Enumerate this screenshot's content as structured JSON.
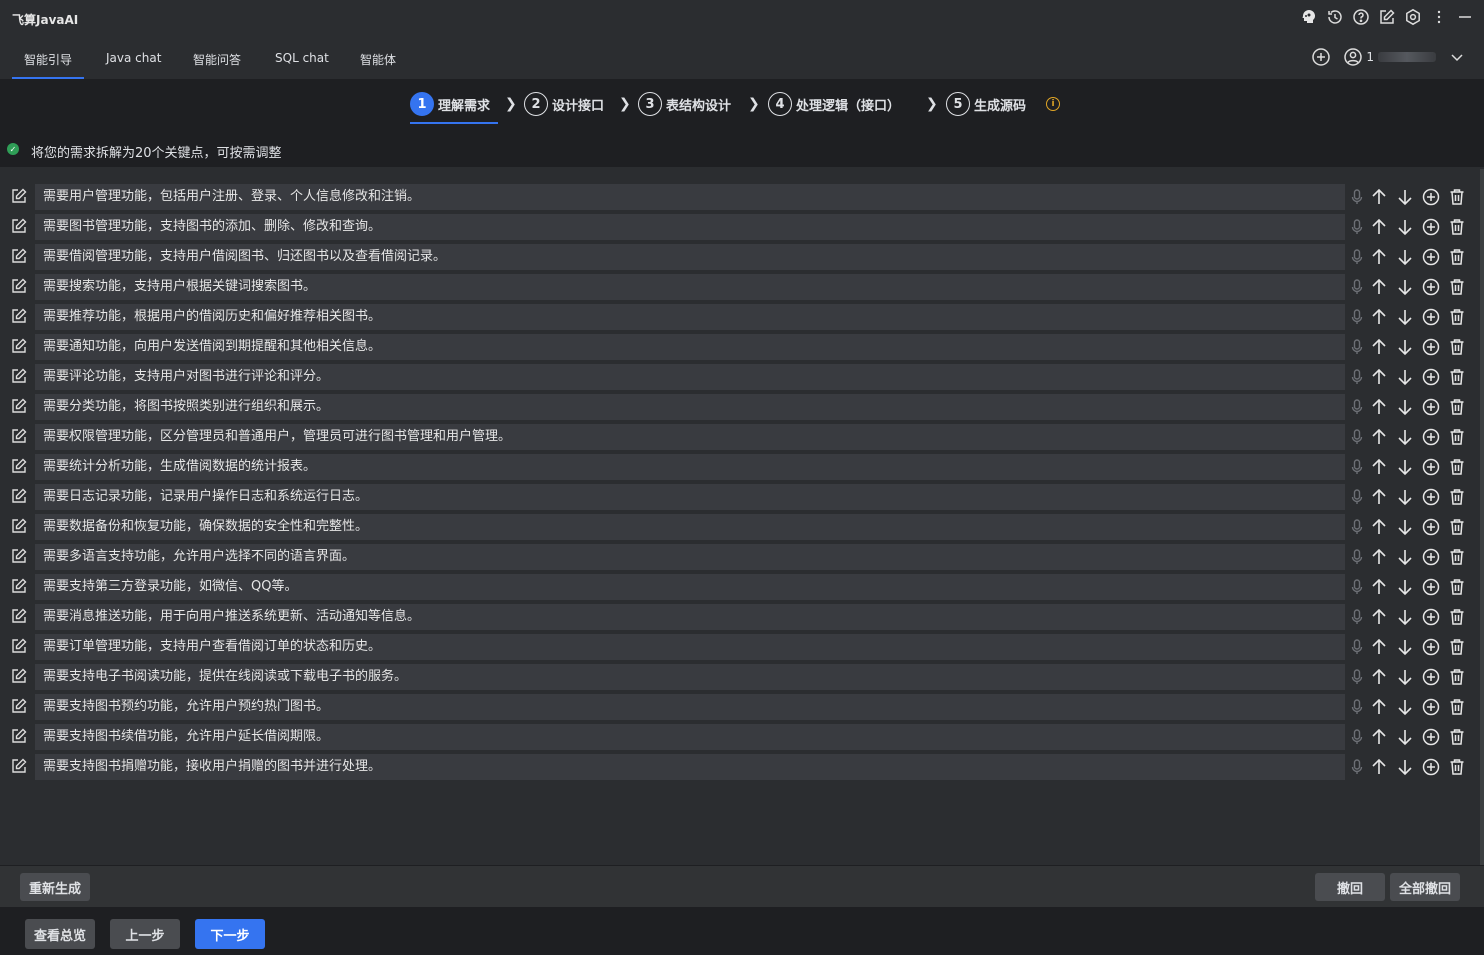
{
  "app": {
    "title": "飞算JavaAI"
  },
  "title_icons": [
    "brain-icon",
    "history-icon",
    "help-icon",
    "edit-icon",
    "settings-icon",
    "more-icon",
    "minimize-icon"
  ],
  "tabs": [
    {
      "label": "智能引导",
      "active": true
    },
    {
      "label": "Java chat",
      "active": false
    },
    {
      "label": "智能问答",
      "active": false
    },
    {
      "label": "SQL chat",
      "active": false
    },
    {
      "label": "智能体",
      "active": false
    }
  ],
  "user": {
    "name_prefix": "1"
  },
  "steps": [
    {
      "num": "1",
      "label": "理解需求",
      "active": true
    },
    {
      "num": "2",
      "label": "设计接口",
      "active": false
    },
    {
      "num": "3",
      "label": "表结构设计",
      "active": false
    },
    {
      "num": "4",
      "label": "处理逻辑（接口）",
      "active": false
    },
    {
      "num": "5",
      "label": "生成源码",
      "active": false
    }
  ],
  "status": {
    "text": "将您的需求拆解为20个关键点，可按需调整"
  },
  "requirements": [
    "需要用户管理功能，包括用户注册、登录、个人信息修改和注销。",
    "需要图书管理功能，支持图书的添加、删除、修改和查询。",
    "需要借阅管理功能，支持用户借阅图书、归还图书以及查看借阅记录。",
    "需要搜索功能，支持用户根据关键词搜索图书。",
    "需要推荐功能，根据用户的借阅历史和偏好推荐相关图书。",
    "需要通知功能，向用户发送借阅到期提醒和其他相关信息。",
    "需要评论功能，支持用户对图书进行评论和评分。",
    "需要分类功能，将图书按照类别进行组织和展示。",
    "需要权限管理功能，区分管理员和普通用户，管理员可进行图书管理和用户管理。",
    "需要统计分析功能，生成借阅数据的统计报表。",
    "需要日志记录功能，记录用户操作日志和系统运行日志。",
    "需要数据备份和恢复功能，确保数据的安全性和完整性。",
    "需要多语言支持功能，允许用户选择不同的语言界面。",
    "需要支持第三方登录功能，如微信、QQ等。",
    "需要消息推送功能，用于向用户推送系统更新、活动通知等信息。",
    "需要订单管理功能，支持用户查看借阅订单的状态和历史。",
    "需要支持电子书阅读功能，提供在线阅读或下载电子书的服务。",
    "需要支持图书预约功能，允许用户预约热门图书。",
    "需要支持图书续借功能，允许用户延长借阅期限。",
    "需要支持图书捐赠功能，接收用户捐赠的图书并进行处理。"
  ],
  "actions": {
    "regenerate": "重新生成",
    "undo": "撤回",
    "undo_all": "全部撤回"
  },
  "footer": {
    "overview": "查看总览",
    "prev": "上一步",
    "next": "下一步"
  },
  "colors": {
    "accent": "#3574f0",
    "success": "#2f9e57",
    "warning": "#e0a526"
  }
}
